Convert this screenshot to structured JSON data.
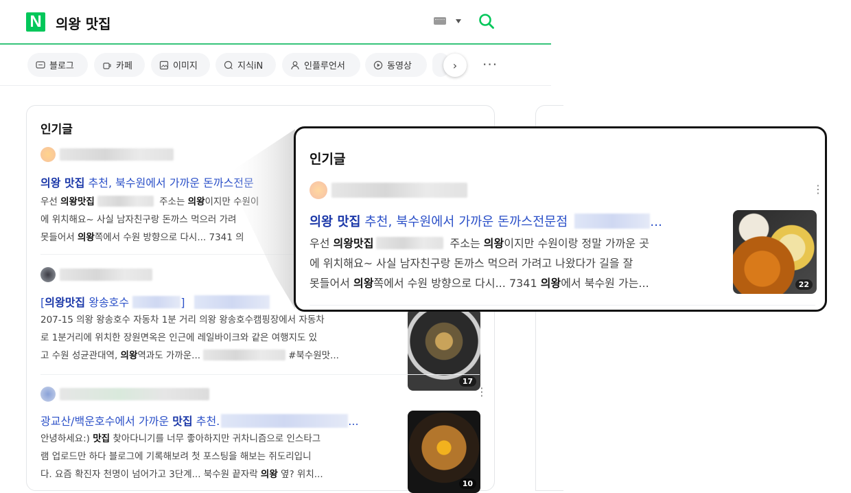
{
  "header": {
    "logo": "N",
    "query": "의왕 맛집",
    "keyboard_icon": "keyboard-icon",
    "search_icon": "search-icon",
    "accent": "#03c75a"
  },
  "tabs": [
    {
      "label": "블로그",
      "icon": "blog-icon"
    },
    {
      "label": "카페",
      "icon": "cafe-icon"
    },
    {
      "label": "이미지",
      "icon": "image-icon"
    },
    {
      "label": "지식iN",
      "icon": "knowledge-icon"
    },
    {
      "label": "인플루언서",
      "icon": "person-icon"
    },
    {
      "label": "동영상",
      "icon": "play-icon"
    }
  ],
  "section": {
    "title": "인기글"
  },
  "posts": [
    {
      "title_bold": "의왕 맛집",
      "title_rest": " 추천, 북수원에서 가까운 돈까스전문점",
      "body_html_parts": [
        "우선 ",
        "의왕맛집",
        " 주소는 ",
        "의왕",
        "이지만 수원이랑 정말 가까운 곳에 위치해요~ 사실 남자친구랑 돈까스 먹으러 가려고 나왔다가 길을 잘 못들어서 ",
        "의왕",
        "쪽에서 수원 방향으로 다시... 7341 ",
        "의왕",
        "에서 북수원 가는..."
      ],
      "image_count": "22"
    },
    {
      "title_prefix": "[",
      "title_bold": "의왕맛집",
      "title_rest": " 왕송호수",
      "title_suffix": "]",
      "body_line1": "207-15 의왕 왕송호수 자동차 1분 거리 의왕 왕송호수캠핑장에서 자동차",
      "body_line2": "로 1분거리에 위치한 장원면옥은 인근에 레일바이크와 같은 여행지도 있",
      "body_line3_a": "고 수원 성균관대역, ",
      "body_line3_b": "의왕",
      "body_line3_c": "역과도 가까운...",
      "body_line3_d": "#북수원맛...",
      "image_count": "17"
    },
    {
      "title_a": "광교산/백운호수에서 가까운 ",
      "title_bold": "맛집",
      "title_b": " 추천.",
      "title_ellipsis": "...",
      "body_line1_a": "안녕하세요:) ",
      "body_line1_b": "맛집",
      "body_line1_c": " 찾아다니기를 너무 좋아하지만 귀차니즘으로 인스타그",
      "body_line2": "램 업로드만 하다 블로그에 기록해보려 첫 포스팅을 해보는 쥐도리입니",
      "body_line3_a": "다. 요즘 확진자 천명이 넘어가고 3단계... 북수원 끝자락 ",
      "body_line3_b": "의왕",
      "body_line3_c": " 옆? 위치...",
      "image_count": "10"
    }
  ],
  "zoom": {
    "title": "인기글",
    "post_title_bold": "의왕 맛집",
    "post_title_rest": " 추천, 북수원에서 가까운 돈까스전문점",
    "post_title_ellipsis": "...",
    "line1_a": "우선 ",
    "line1_b": "의왕맛집",
    "line1_c": " 주소는 ",
    "line1_d": "의왕",
    "line1_e": "이지만 수원이랑 정말 가까운 곳",
    "line2": "에 위치해요~ 사실 남자친구랑 돈까스 먹으러 가려고 나왔다가 길을 잘",
    "line3_a": "못들어서 ",
    "line3_b": "의왕",
    "line3_c": "쪽에서 수원 방향으로 다시... 7341 ",
    "line3_d": "의왕",
    "line3_e": "에서 북수원 가는...",
    "image_count": "22"
  },
  "snippet1": {
    "title_bold": "의왕 맛집",
    "title_rest": " 추천, 북수원에서 가까운 돈까스전문",
    "line1_a": "우선 ",
    "line1_b": "의왕맛집",
    "line1_c": " 주소는 ",
    "line1_d": "의왕",
    "line1_e": "이지만 수원이",
    "line2": "에 위치해요~ 사실 남자친구랑 돈까스 먹으러 가려",
    "line3_a": "못들어서 ",
    "line3_b": "의왕",
    "line3_c": "쪽에서 수원 방향으로 다시... 7341 의"
  }
}
